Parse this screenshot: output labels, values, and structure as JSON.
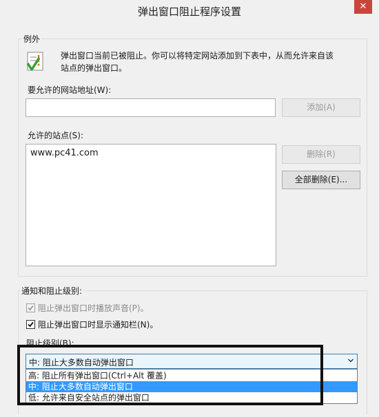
{
  "window": {
    "title": "弹出窗口阻止程序设置",
    "close_glyph": "✕"
  },
  "exceptions": {
    "group_label": "例外",
    "info_line1": "弹出窗口当前已被阻止。你可以将特定网站添加到下表中，从而允许来自该",
    "info_line2": "站点的弹出窗口。",
    "address_label": "要允许的网站地址(W):",
    "address_value": "",
    "add_button": "添加(A)",
    "allowed_label": "允许的站点(S):",
    "allowed_sites": [
      "www.pc41.com"
    ],
    "remove_button": "删除(R)",
    "remove_all_button": "全部删除(E)..."
  },
  "notification": {
    "group_label": "通知和阻止级别:",
    "play_sound": {
      "label": "阻止弹出窗口时播放声音(P)。",
      "checked": true,
      "enabled": false
    },
    "show_bar": {
      "label": "阻止弹出窗口时显示通知栏(N)。",
      "checked": true,
      "enabled": true
    },
    "level_label": "阻止级别(B):",
    "level_selected": "中: 阻止大多数自动弹出窗口",
    "level_options": [
      "高: 阻止所有弹出窗口(Ctrl+Alt 覆盖)",
      "中: 阻止大多数自动弹出窗口",
      "低: 允许来自安全站点的弹出窗口"
    ]
  },
  "icons": {
    "info_icon": "warning-checklist-icon",
    "check_icon": "checkmark-icon",
    "arrow_icon": "chevron-down-icon"
  },
  "colors": {
    "selection": "#3399ff",
    "close_button": "#c7463b",
    "dialog_bg": "#f0f0f0"
  }
}
